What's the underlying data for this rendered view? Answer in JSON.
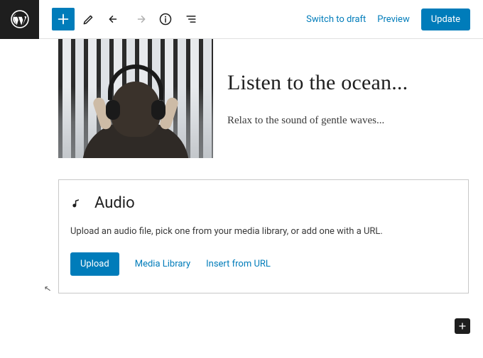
{
  "topbar": {
    "switch_draft": "Switch to draft",
    "preview": "Preview",
    "update": "Update"
  },
  "post": {
    "title": "Listen to the ocean...",
    "subtitle": "Relax to the sound of gentle waves..."
  },
  "audio_block": {
    "title": "Audio",
    "description": "Upload an audio file, pick one from your media library, or add one with a URL.",
    "upload": "Upload",
    "media_library": "Media Library",
    "insert_url": "Insert from URL"
  },
  "colors": {
    "primary": "#007cba",
    "dark": "#1e1e1e"
  }
}
